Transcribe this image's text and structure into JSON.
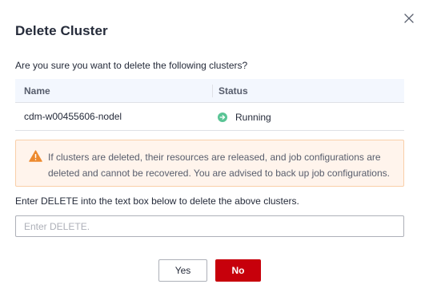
{
  "dialog": {
    "title": "Delete Cluster",
    "question": "Are you sure you want to delete the following clusters?",
    "table": {
      "columns": [
        "Name",
        "Status"
      ],
      "rows": [
        {
          "name": "cdm-w00455606-nodel",
          "status": "Running",
          "status_icon": "arrow-right-circle-icon",
          "status_color": "#5ac495"
        }
      ]
    },
    "warning": {
      "icon": "warning-triangle-icon",
      "color": "#ed8a2f",
      "text": "If clusters are deleted, their resources are released, and job configurations are deleted and cannot be recovered. You are advised to back up job configurations."
    },
    "instruction": "Enter DELETE into the text box below to delete the above clusters.",
    "input": {
      "value": "",
      "placeholder": "Enter DELETE."
    },
    "buttons": {
      "yes": "Yes",
      "no": "No"
    },
    "accent_color": "#c7000b"
  }
}
